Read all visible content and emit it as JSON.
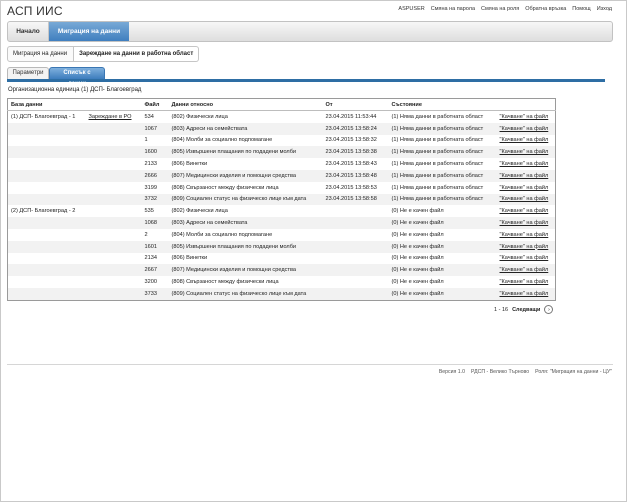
{
  "app": {
    "title": "АСП ИИС"
  },
  "toplinks": [
    "ASPUSER",
    "Смяна на парола",
    "Смяна на роля",
    "Обратна връзка",
    "Помощ",
    "Изход"
  ],
  "nav": {
    "home": "Начало",
    "active": "Миграция на данни"
  },
  "breadcrumb": {
    "first": "Миграция на данни",
    "current": "Зареждане на данни в работна област"
  },
  "subtabs": {
    "params": "Параметри",
    "list": "Списък с данни"
  },
  "org_label": "Организационна единица (1) ДСП- Благоевград",
  "table": {
    "headers": [
      "База данни",
      "",
      "Файл",
      "Данни относно",
      "От",
      "Състояние",
      ""
    ],
    "rows": [
      {
        "db": "(1) ДСП- Благоевград - 1",
        "action": "Зареждане в РО",
        "file": "534",
        "about": "(802) Физически лица",
        "from": "23.04.2015 11:53:44",
        "status": "(1) Няма данни в работната област",
        "link": "\"Качване\" на файл"
      },
      {
        "db": "",
        "action": "",
        "file": "1067",
        "about": "(803) Адреси на семействата",
        "from": "23.04.2015 13:58:24",
        "status": "(1) Няма данни в работната област",
        "link": "\"Качване\" на файл"
      },
      {
        "db": "",
        "action": "",
        "file": "1",
        "about": "(804) Молби за социално подпомагане",
        "from": "23.04.2015 13:58:32",
        "status": "(1) Няма данни в работната област",
        "link": "\"Качване\" на файл"
      },
      {
        "db": "",
        "action": "",
        "file": "1600",
        "about": "(805) Извършени плащания по подадени молби",
        "from": "23.04.2015 13:58:38",
        "status": "(1) Няма данни в работната област",
        "link": "\"Качване\" на файл"
      },
      {
        "db": "",
        "action": "",
        "file": "2133",
        "about": "(806) Винетки",
        "from": "23.04.2015 13:58:43",
        "status": "(1) Няма данни в работната област",
        "link": "\"Качване\" на файл"
      },
      {
        "db": "",
        "action": "",
        "file": "2666",
        "about": "(807) Медицински изделия и помощни средства",
        "from": "23.04.2015 13:58:48",
        "status": "(1) Няма данни в работната област",
        "link": "\"Качване\" на файл"
      },
      {
        "db": "",
        "action": "",
        "file": "3199",
        "about": "(808) Свързаност между физически лица",
        "from": "23.04.2015 13:58:53",
        "status": "(1) Няма данни в работната област",
        "link": "\"Качване\" на файл"
      },
      {
        "db": "",
        "action": "",
        "file": "3732",
        "about": "(809) Социален статус на физическо лице към дата",
        "from": "23.04.2015 13:58:58",
        "status": "(1) Няма данни в работната област",
        "link": "\"Качване\" на файл"
      },
      {
        "db": "(2) ДСП- Благоевград - 2",
        "action": "",
        "file": "535",
        "about": "(802) Физически лица",
        "from": "",
        "status": "(0) Не е качен файл",
        "link": "\"Качване\" на файл"
      },
      {
        "db": "",
        "action": "",
        "file": "1068",
        "about": "(803) Адреси на семействата",
        "from": "",
        "status": "(0) Не е качен файл",
        "link": "\"Качване\" на файл"
      },
      {
        "db": "",
        "action": "",
        "file": "2",
        "about": "(804) Молби за социално подпомагане",
        "from": "",
        "status": "(0) Не е качен файл",
        "link": "\"Качване\" на файл"
      },
      {
        "db": "",
        "action": "",
        "file": "1601",
        "about": "(805) Извършени плащания по подадени молби",
        "from": "",
        "status": "(0) Не е качен файл",
        "link": "\"Качване\" на файл"
      },
      {
        "db": "",
        "action": "",
        "file": "2134",
        "about": "(806) Винетки",
        "from": "",
        "status": "(0) Не е качен файл",
        "link": "\"Качване\" на файл"
      },
      {
        "db": "",
        "action": "",
        "file": "2667",
        "about": "(807) Медицински изделия и помощни средства",
        "from": "",
        "status": "(0) Не е качен файл",
        "link": "\"Качване\" на файл"
      },
      {
        "db": "",
        "action": "",
        "file": "3200",
        "about": "(808) Свързаност между физически лица",
        "from": "",
        "status": "(0) Не е качен файл",
        "link": "\"Качване\" на файл"
      },
      {
        "db": "",
        "action": "",
        "file": "3733",
        "about": "(809) Социален статус на физическо лице към дата",
        "from": "",
        "status": "(0) Не е качен файл",
        "link": "\"Качване\" на файл"
      }
    ]
  },
  "pager": {
    "range": "1 - 16",
    "next": "Следващи",
    "next_icon": "chevron-right-circle-icon"
  },
  "footer": [
    "Версия 1.0",
    "РДСП - Велико Търново",
    "Роля: \"Миграция на данни - ЦУ\""
  ],
  "colors": {
    "accent": "#3f7fbf",
    "tab_strip": "#2e6ea4",
    "row_alt": "#f2f2f2"
  }
}
